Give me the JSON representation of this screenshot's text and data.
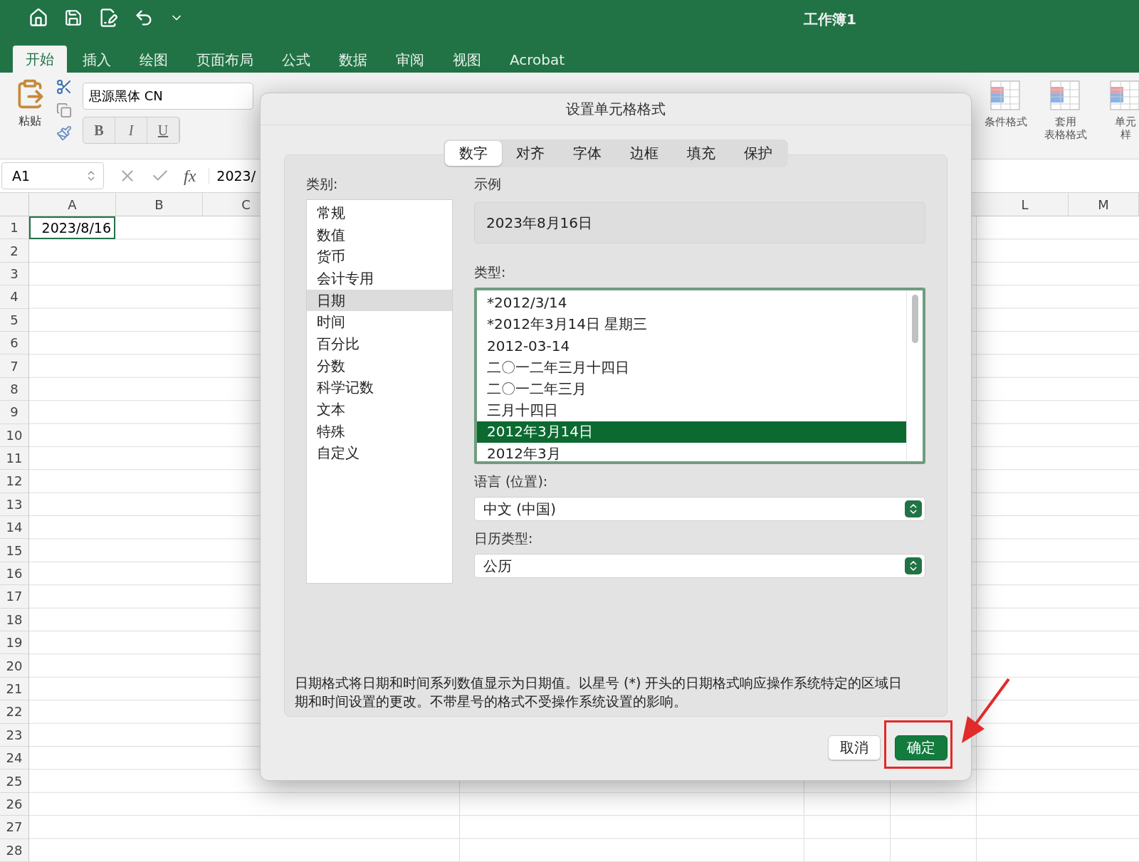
{
  "window": {
    "title": "工作簿1"
  },
  "ribbon_tabs": [
    {
      "label": "开始",
      "selected": true
    },
    {
      "label": "插入",
      "selected": false
    },
    {
      "label": "绘图",
      "selected": false
    },
    {
      "label": "页面布局",
      "selected": false
    },
    {
      "label": "公式",
      "selected": false
    },
    {
      "label": "数据",
      "selected": false
    },
    {
      "label": "审阅",
      "selected": false
    },
    {
      "label": "视图",
      "selected": false
    },
    {
      "label": "Acrobat",
      "selected": false
    }
  ],
  "ribbon": {
    "paste_label": "粘贴",
    "font_name": "思源黑体 CN",
    "bold": "B",
    "italic": "I",
    "underline": "U",
    "styles": [
      {
        "lines": [
          "条件格式"
        ]
      },
      {
        "lines": [
          "套用",
          "表格格式"
        ]
      },
      {
        "lines": [
          "单元",
          "样"
        ]
      }
    ]
  },
  "formula_bar": {
    "name_box": "A1",
    "fx": "fx",
    "value": "2023/"
  },
  "sheet": {
    "columns_left": [
      "A",
      "B",
      "C"
    ],
    "columns_right": [
      "L",
      "M"
    ],
    "rows": [
      "1",
      "2",
      "3",
      "4",
      "5",
      "6",
      "7",
      "8",
      "9",
      "10",
      "11",
      "12",
      "13",
      "14",
      "15",
      "16",
      "17",
      "18",
      "19",
      "20",
      "21",
      "22",
      "23",
      "24",
      "25",
      "26",
      "27",
      "28"
    ],
    "active_cell": {
      "value": "2023/8/16"
    }
  },
  "dialog": {
    "title": "设置单元格格式",
    "tabs": [
      {
        "label": "数字",
        "selected": true
      },
      {
        "label": "对齐",
        "selected": false
      },
      {
        "label": "字体",
        "selected": false
      },
      {
        "label": "边框",
        "selected": false
      },
      {
        "label": "填充",
        "selected": false
      },
      {
        "label": "保护",
        "selected": false
      }
    ],
    "category_label": "类别:",
    "categories": [
      {
        "label": "常规",
        "selected": false
      },
      {
        "label": "数值",
        "selected": false
      },
      {
        "label": "货币",
        "selected": false
      },
      {
        "label": "会计专用",
        "selected": false
      },
      {
        "label": "日期",
        "selected": true
      },
      {
        "label": "时间",
        "selected": false
      },
      {
        "label": "百分比",
        "selected": false
      },
      {
        "label": "分数",
        "selected": false
      },
      {
        "label": "科学记数",
        "selected": false
      },
      {
        "label": "文本",
        "selected": false
      },
      {
        "label": "特殊",
        "selected": false
      },
      {
        "label": "自定义",
        "selected": false
      }
    ],
    "sample_label": "示例",
    "sample": "2023年8月16日",
    "type_label": "类型:",
    "types": [
      {
        "label": "*2012/3/14",
        "selected": false
      },
      {
        "label": "*2012年3月14日 星期三",
        "selected": false
      },
      {
        "label": "2012-03-14",
        "selected": false
      },
      {
        "label": "二〇一二年三月十四日",
        "selected": false
      },
      {
        "label": "二〇一二年三月",
        "selected": false
      },
      {
        "label": "三月十四日",
        "selected": false
      },
      {
        "label": "2012年3月14日",
        "selected": true
      },
      {
        "label": "2012年3月",
        "selected": false
      }
    ],
    "locale_label": "语言 (位置):",
    "locale": "中文 (中国)",
    "calendar_label": "日历类型:",
    "calendar": "公历",
    "description": "日期格式将日期和时间系列数值显示为日期值。以星号 (*) 开头的日期格式响应操作系统特定的区域日期和时间设置的更改。不带星号的格式不受操作系统设置的影响。",
    "buttons": [
      {
        "label": "取消",
        "kind": "secondary"
      },
      {
        "label": "确定",
        "kind": "primary"
      }
    ]
  }
}
